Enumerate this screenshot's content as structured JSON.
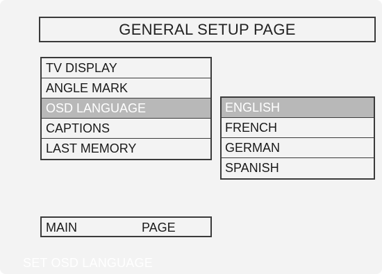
{
  "colors": {
    "background": "#f3f3f3",
    "border": "#3a3a3a",
    "highlight": "#b8b8b8",
    "highlight_text": "#ffffff"
  },
  "header": {
    "title": "GENERAL SETUP PAGE"
  },
  "menu": {
    "selected_index": 2,
    "items": [
      {
        "label": "TV DISPLAY"
      },
      {
        "label": "ANGLE MARK"
      },
      {
        "label": "OSD LANGUAGE"
      },
      {
        "label": "CAPTIONS"
      },
      {
        "label": "LAST MEMORY"
      }
    ]
  },
  "options": {
    "selected_index": 0,
    "items": [
      {
        "label": "ENGLISH"
      },
      {
        "label": "FRENCH"
      },
      {
        "label": "GERMAN"
      },
      {
        "label": "SPANISH"
      }
    ]
  },
  "footer": {
    "main_label": "MAIN",
    "page_label": "PAGE"
  },
  "status": {
    "text": "SET OSD LANGUAGE"
  }
}
